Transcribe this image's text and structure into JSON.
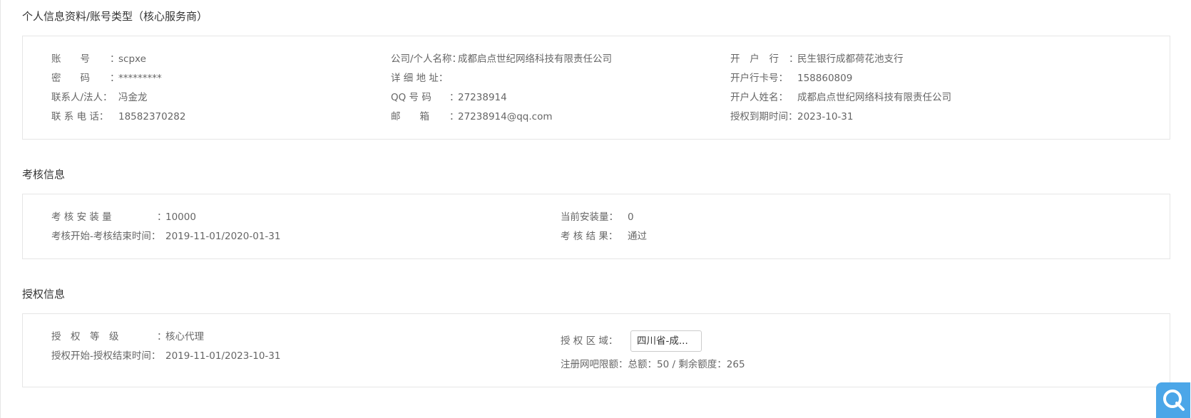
{
  "personal": {
    "title": "个人信息资料/账号类型（核心服务商）",
    "account_label": "账　　号",
    "account_value": "scpxe",
    "password_label": "密　　码",
    "password_value": "*********",
    "contact_label": "联系人/法人：",
    "contact_value": "冯金龙",
    "phone_label": "联 系 电 话：",
    "phone_value": "18582370282",
    "company_label": "公司/个人名称：",
    "company_value": "成都启点世纪网络科技有限责任公司",
    "address_label": "详 细 地 址：",
    "address_value": "",
    "qq_label": "QQ 号 码",
    "qq_value": "27238914",
    "email_label": "邮　　箱",
    "email_value": "27238914@qq.com",
    "bank_label": "开 户 行",
    "bank_value": "民生银行成都荷花池支行",
    "card_label": "开户行卡号：",
    "card_value": "158860809",
    "holder_label": "开户人姓名：",
    "holder_value": "成都启点世纪网络科技有限责任公司",
    "expire_label": "授权到期时间：",
    "expire_value": "2023-10-31"
  },
  "assessment": {
    "title": "考核信息",
    "install_label": "考 核 安 装 量",
    "install_value": "10000",
    "period_label": "考核开始-考核结束时间：",
    "period_value": "2019-11-01/2020-01-31",
    "current_label": "当前安装量：",
    "current_value": "0",
    "result_label": "考 核 结 果：",
    "result_value": "通过"
  },
  "authorization": {
    "title": "授权信息",
    "level_label": "授　权　等　级",
    "level_value": "核心代理",
    "period_label": "授权开始-授权结束时间：",
    "period_value": "2019-11-01/2023-10-31",
    "region_label": "授 权 区 域：",
    "region_value": "四川省-成...",
    "quota_label": "注册网吧限额：",
    "quota_value": "总额：50 / 剩余额度：265"
  },
  "colors": {
    "label_text": "#666666",
    "border": "#e6e6e6",
    "chat_button": "#4ba6e8"
  },
  "icons": {
    "chat": "chat-q-icon"
  }
}
